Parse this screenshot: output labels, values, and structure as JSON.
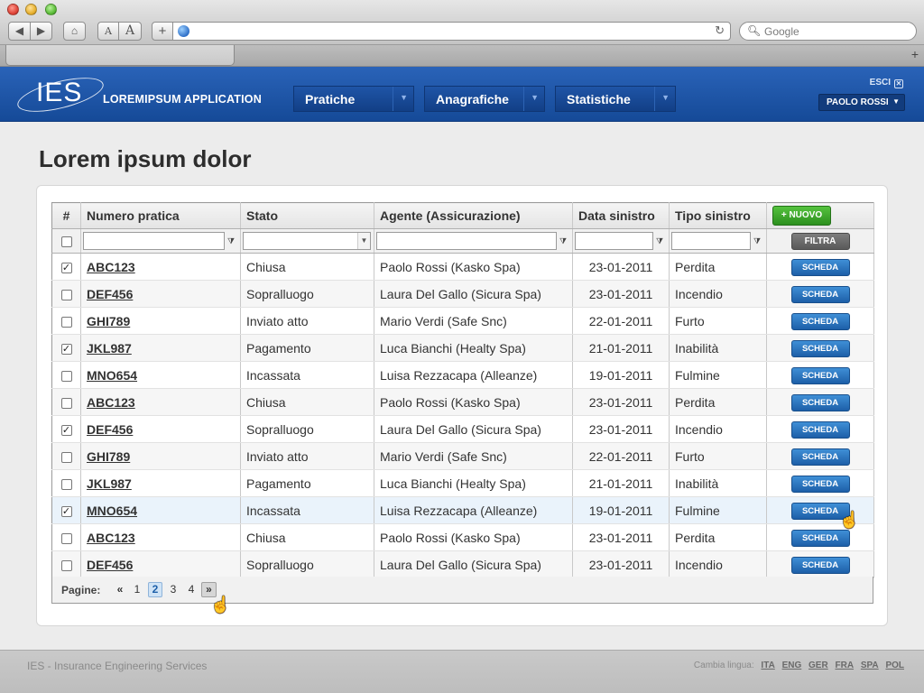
{
  "browser": {
    "search_placeholder": "Google",
    "font_small": "A",
    "font_large": "A"
  },
  "header": {
    "logo_text": "IES",
    "app_name": "LOREMIPSUM APPLICATION",
    "nav": [
      {
        "label": "Pratiche"
      },
      {
        "label": "Anagrafiche"
      },
      {
        "label": "Statistiche"
      }
    ],
    "logout_label": "ESCI",
    "user_name": "PAOLO ROSSI"
  },
  "page": {
    "title": "Lorem ipsum dolor"
  },
  "table": {
    "columns": {
      "hash": "#",
      "numero": "Numero pratica",
      "stato": "Stato",
      "agente": "Agente (Assicurazione)",
      "data": "Data sinistro",
      "tipo": "Tipo sinistro"
    },
    "new_button": "+ NUOVO",
    "filter_button": "FILTRA",
    "row_button": "SCHEDA",
    "rows": [
      {
        "checked": "✓",
        "numero": "ABC123",
        "stato": "Chiusa",
        "agente": "Paolo Rossi (Kasko Spa)",
        "data": "23-01-2011",
        "tipo": "Perdita"
      },
      {
        "checked": "",
        "numero": "DEF456",
        "stato": "Sopralluogo",
        "agente": "Laura Del Gallo (Sicura Spa)",
        "data": "23-01-2011",
        "tipo": "Incendio"
      },
      {
        "checked": "",
        "numero": "GHI789",
        "stato": "Inviato atto",
        "agente": "Mario Verdi (Safe Snc)",
        "data": "22-01-2011",
        "tipo": "Furto"
      },
      {
        "checked": "✓",
        "numero": "JKL987",
        "stato": "Pagamento",
        "agente": "Luca Bianchi (Healty Spa)",
        "data": "21-01-2011",
        "tipo": "Inabilità"
      },
      {
        "checked": "",
        "numero": "MNO654",
        "stato": "Incassata",
        "agente": "Luisa Rezzacapa (Alleanze)",
        "data": "19-01-2011",
        "tipo": "Fulmine"
      },
      {
        "checked": "",
        "numero": "ABC123",
        "stato": "Chiusa",
        "agente": "Paolo Rossi (Kasko Spa)",
        "data": "23-01-2011",
        "tipo": "Perdita"
      },
      {
        "checked": "✓",
        "numero": "DEF456",
        "stato": "Sopralluogo",
        "agente": "Laura Del Gallo (Sicura Spa)",
        "data": "23-01-2011",
        "tipo": "Incendio"
      },
      {
        "checked": "",
        "numero": "GHI789",
        "stato": "Inviato atto",
        "agente": "Mario Verdi (Safe Snc)",
        "data": "22-01-2011",
        "tipo": "Furto"
      },
      {
        "checked": "",
        "numero": "JKL987",
        "stato": "Pagamento",
        "agente": "Luca Bianchi (Healty Spa)",
        "data": "21-01-2011",
        "tipo": "Inabilità"
      },
      {
        "checked": "✓",
        "numero": "MNO654",
        "stato": "Incassata",
        "agente": "Luisa Rezzacapa (Alleanze)",
        "data": "19-01-2011",
        "tipo": "Fulmine"
      },
      {
        "checked": "",
        "numero": "ABC123",
        "stato": "Chiusa",
        "agente": "Paolo Rossi (Kasko Spa)",
        "data": "23-01-2011",
        "tipo": "Perdita"
      },
      {
        "checked": "",
        "numero": "DEF456",
        "stato": "Sopralluogo",
        "agente": "Laura Del Gallo (Sicura Spa)",
        "data": "23-01-2011",
        "tipo": "Incendio"
      }
    ]
  },
  "pager": {
    "label": "Pagine:",
    "prev": "«",
    "pages": [
      "1",
      "2",
      "3",
      "4"
    ],
    "current": "2",
    "next": "»"
  },
  "footer": {
    "company": "IES - Insurance Engineering Services",
    "change_language": "Cambia lingua:",
    "languages": [
      "ITA",
      "ENG",
      "GER",
      "FRA",
      "SPA",
      "POL"
    ]
  },
  "colors": {
    "header_blue": "#1d55a8",
    "new_green": "#3aa52a",
    "scheda_blue": "#2a74c0",
    "filter_gray": "#6b6b6b",
    "highlight_row": "#eaf3fb"
  }
}
